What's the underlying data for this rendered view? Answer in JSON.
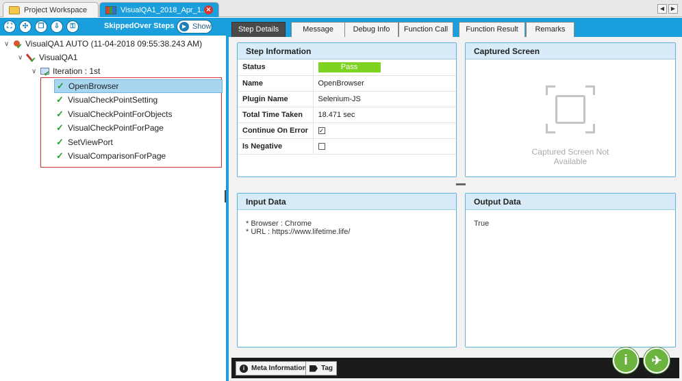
{
  "window_tabs": [
    {
      "label": "Project Workspace",
      "icon": "folder-icon"
    },
    {
      "label": "VisualQA1_2018_Apr_1...",
      "icon": "report-icon"
    }
  ],
  "left_panel": {
    "title": "SkippedOver Steps",
    "show_label": "Show",
    "tree": {
      "root": "VisualQA1 AUTO (11-04-2018 09:55:38.243 AM)",
      "suite": "VisualQA1",
      "iteration": "Iteration : 1st",
      "steps": [
        "OpenBrowser",
        "VisualCheckPointSetting",
        "VisualCheckPointForObjects",
        "VisualCheckPointForPage",
        "SetViewPort",
        "VisualComparisonForPage"
      ],
      "selected": "OpenBrowser"
    }
  },
  "tabs": [
    "Step Details",
    "Message",
    "Debug Info",
    "Function Call",
    "Function Result",
    "Remarks"
  ],
  "active_tab": "Step Details",
  "step_info": {
    "title": "Step Information",
    "rows": [
      {
        "key": "Status",
        "value": "Pass"
      },
      {
        "key": "Name",
        "value": "OpenBrowser"
      },
      {
        "key": "Plugin Name",
        "value": "Selenium-JS"
      },
      {
        "key": "Total Time Taken",
        "value": "18.471 sec"
      },
      {
        "key": "Continue On Error",
        "value": "checked"
      },
      {
        "key": "Is Negative",
        "value": "unchecked"
      }
    ]
  },
  "captured_screen": {
    "title": "Captured Screen",
    "message_line1": "Captured Screen Not",
    "message_line2": "Available"
  },
  "input_data": {
    "title": "Input Data",
    "lines": [
      "* Browser : Chrome",
      "* URL : https://www.lifetime.life/"
    ]
  },
  "output_data": {
    "title": "Output Data",
    "value": "True"
  },
  "bottom_bar": {
    "meta_label": "Meta Information",
    "tag_label": "Tag"
  },
  "colors": {
    "accent": "#1a9fdc",
    "pass": "#7ed321",
    "fab": "#6cb33f",
    "highlight_box": "#d32f2f"
  }
}
